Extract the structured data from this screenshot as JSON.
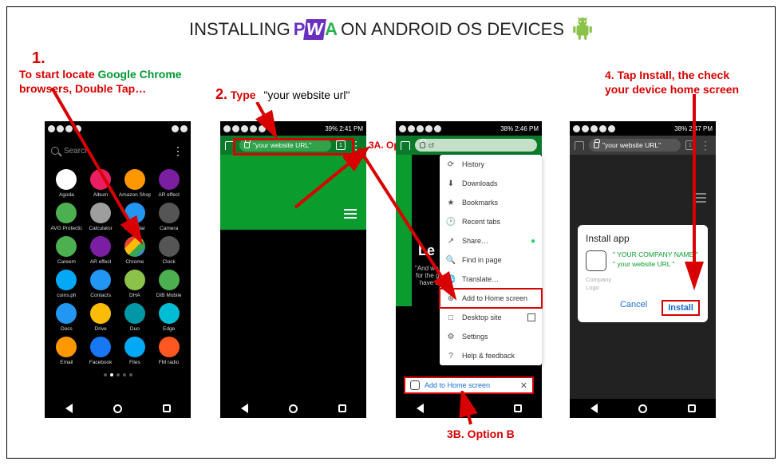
{
  "title": {
    "pre": "INSTALLING ",
    "post": " ON ANDROID OS DEVICES"
  },
  "pwa": {
    "p": "P",
    "w": "W",
    "a": "A"
  },
  "steps": {
    "s1_num": "1.",
    "s1_a": "To start locate ",
    "s1_b": "Google Chrome",
    "s1_c": "browsers, Double Tap…",
    "s2_num": "2.",
    "s2_a": "Type",
    "s2_b": "\"your website url\"",
    "s3a": "3A. Option A",
    "s3b": "3B. Option B",
    "s4_a": "4. Tap Install, the check",
    "s4_b": "your device home screen"
  },
  "status": {
    "batt1": "39%",
    "time1": "2:41 PM",
    "batt2": "38%",
    "time2": "2:46 PM",
    "batt3": "38%",
    "time3": "2:47 PM"
  },
  "p1": {
    "search": "Search",
    "apps": [
      "Agoda",
      "Album",
      "Amazon Shopping",
      "AR effect",
      "AVG Protection",
      "Calculator",
      "Calendar",
      "Camera",
      "Careem",
      "AR effect",
      "Chrome",
      "Clock",
      "coins.ph",
      "Contacts",
      "DHA",
      "DIB Mobile",
      "Docs",
      "Drive",
      "Duo",
      "Edge",
      "Email",
      "Facebook",
      "Files",
      "FM radio"
    ],
    "app_colors": [
      "#fff",
      "#e91e63",
      "#ff9800",
      "#7b1fa2",
      "#4caf50",
      "#9e9e9e",
      "#2196f3",
      "#555",
      "#4caf50",
      "#7b1fa2",
      "linear-gradient(135deg,#ea4335 0 30%,#fbbc05 30% 55%,#34a853 55% 78%,#4285f4 78%)",
      "#555",
      "#03a9f4",
      "#2196f3",
      "#8bc34a",
      "#4caf50",
      "#2196f3",
      "#fbbc05",
      "#0097a7",
      "#00bcd4",
      "#ff9800",
      "#1877f2",
      "#03a9f4",
      "#ff5722"
    ]
  },
  "p2": {
    "url": "\"your website URL\"",
    "tabcount": "1"
  },
  "p3": {
    "url_short": "cf",
    "menu": [
      "History",
      "Downloads",
      "Bookmarks",
      "Recent tabs",
      "Share…",
      "Find in page",
      "Translate…",
      "Add to Home screen",
      "Desktop site",
      "Settings",
      "Help & feedback"
    ],
    "body_head": "Le",
    "body_lines": "\"And we k\nfor the go\nhave b",
    "addbar_text": "Add to Home screen"
  },
  "p4": {
    "url": "\"your website URL\"",
    "dlg_title": "Install app",
    "line1": "\" YOUR COMPANY NAME \"",
    "line2": "\" your website URL \"",
    "sub1": "Company",
    "sub2": "Logo",
    "cancel": "Cancel",
    "install": "Install"
  }
}
